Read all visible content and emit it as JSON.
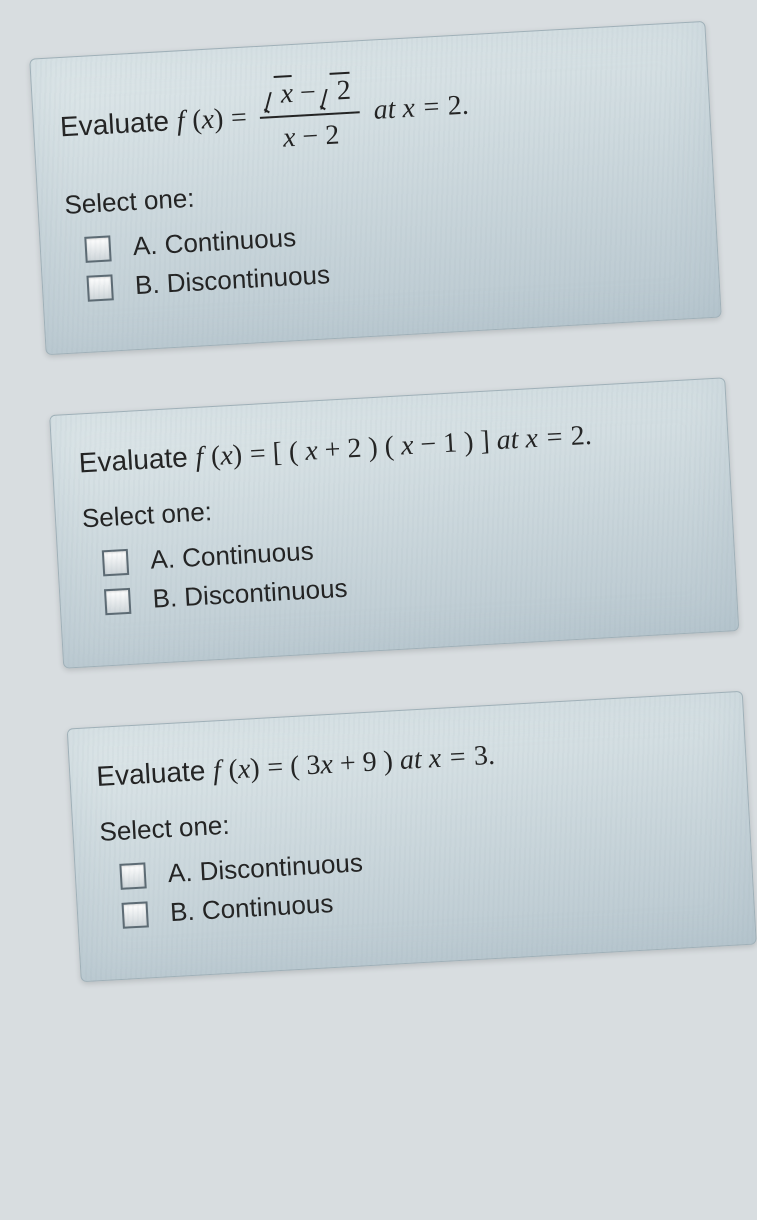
{
  "questions": [
    {
      "prefix": "Evaluate ",
      "fn_f": "f",
      "fn_x": "x",
      "eq": " = ",
      "numerator_part1": "x",
      "numerator_minus": " − ",
      "numerator_part2": "2",
      "denominator": "x − 2",
      "tail1": "  at x = ",
      "tail_val": "2.",
      "select": "Select one:",
      "options": [
        {
          "label": "A. Continuous"
        },
        {
          "label": "B. Discontinuous"
        }
      ]
    },
    {
      "prefix": "Evaluate ",
      "fn_f": "f",
      "fn_x": "x",
      "eq": " = ",
      "expr": "[ ( x + 2 ) ( x − 1 ) ] ",
      "tail_it": "at x = ",
      "tail_val": "2.",
      "select": "Select one:",
      "options": [
        {
          "label": "A. Continuous"
        },
        {
          "label": "B. Discontinuous"
        }
      ]
    },
    {
      "prefix": "Evaluate ",
      "fn_f": "f",
      "fn_x": "x",
      "eq": " = ",
      "expr": "( 3x + 9 )  ",
      "tail_it": "at  x = ",
      "tail_val": "3.",
      "select": "Select one:",
      "options": [
        {
          "label": "A. Discontinuous"
        },
        {
          "label": "B. Continuous"
        }
      ]
    }
  ]
}
